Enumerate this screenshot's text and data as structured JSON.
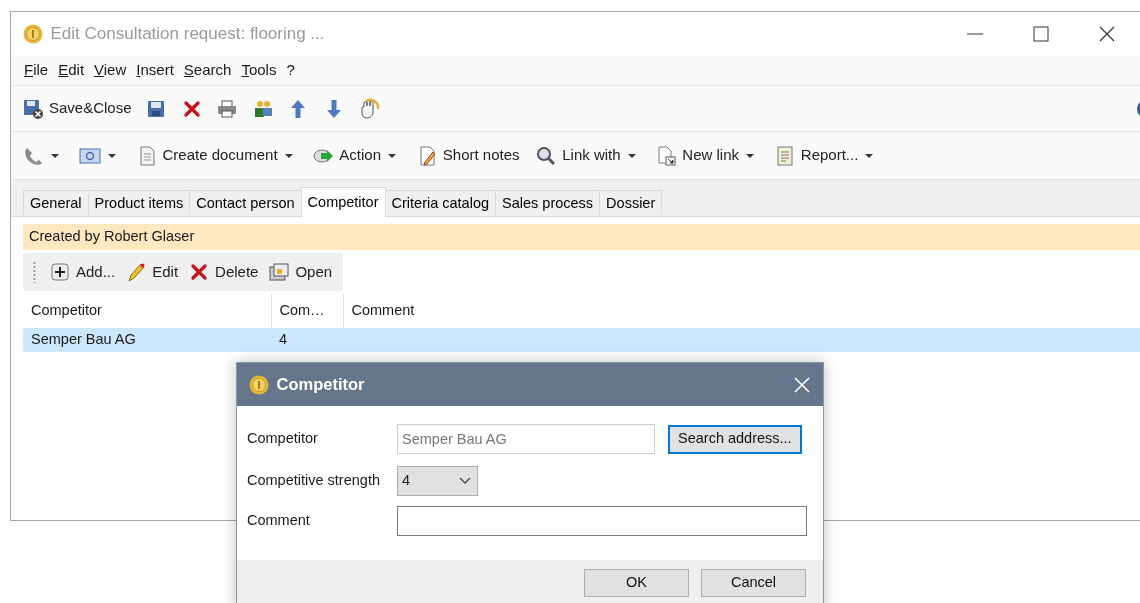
{
  "window": {
    "title": "Edit Consultation request: flooring ...",
    "active": false
  },
  "menu": [
    {
      "label": "File"
    },
    {
      "label": "Edit"
    },
    {
      "label": "View"
    },
    {
      "label": "Insert"
    },
    {
      "label": "Search"
    },
    {
      "label": "Tools"
    },
    {
      "label": "?"
    }
  ],
  "toolbar": [
    {
      "label": "Save&Close"
    }
  ],
  "action_bar": [
    {
      "dropdown": true
    },
    {
      "dropdown": true
    },
    {
      "label": "Create document",
      "dropdown": true
    },
    {
      "label": "Action",
      "dropdown": true
    },
    {
      "label": "Short notes",
      "dropdown": false
    },
    {
      "label": "Link with",
      "dropdown": true
    },
    {
      "label": "New link",
      "dropdown": true
    },
    {
      "label": "Report...",
      "dropdown": true
    }
  ],
  "tabs": [
    {
      "label": "General",
      "selected": false
    },
    {
      "label": "Product items",
      "selected": false
    },
    {
      "label": "Contact person",
      "selected": false
    },
    {
      "label": "Competitor",
      "selected": true
    },
    {
      "label": "Criteria catalog",
      "selected": false
    },
    {
      "label": "Sales process",
      "selected": false
    },
    {
      "label": "Dossier",
      "selected": false
    }
  ],
  "info_bar": "Created by Robert Glaser",
  "grid_toolbar": [
    {
      "label": "Add..."
    },
    {
      "label": "Edit"
    },
    {
      "label": "Delete"
    },
    {
      "label": "Open"
    }
  ],
  "table": {
    "columns": [
      "Competitor",
      "Com…",
      "Comment"
    ],
    "rows": [
      {
        "cells": [
          "Semper Bau AG",
          "4"
        ],
        "selected": true
      }
    ]
  },
  "dialog": {
    "title": "Competitor",
    "fields": [
      {
        "kind": "text",
        "label": "Competitor",
        "value": "Semper Bau AG",
        "disabled": true,
        "button": "Search address...",
        "button_focused": true
      },
      {
        "kind": "select",
        "label": "Competitive strength",
        "value": "4"
      },
      {
        "kind": "text",
        "label": "Comment",
        "disabled": false
      }
    ],
    "buttons": [
      "OK",
      "Cancel"
    ]
  }
}
